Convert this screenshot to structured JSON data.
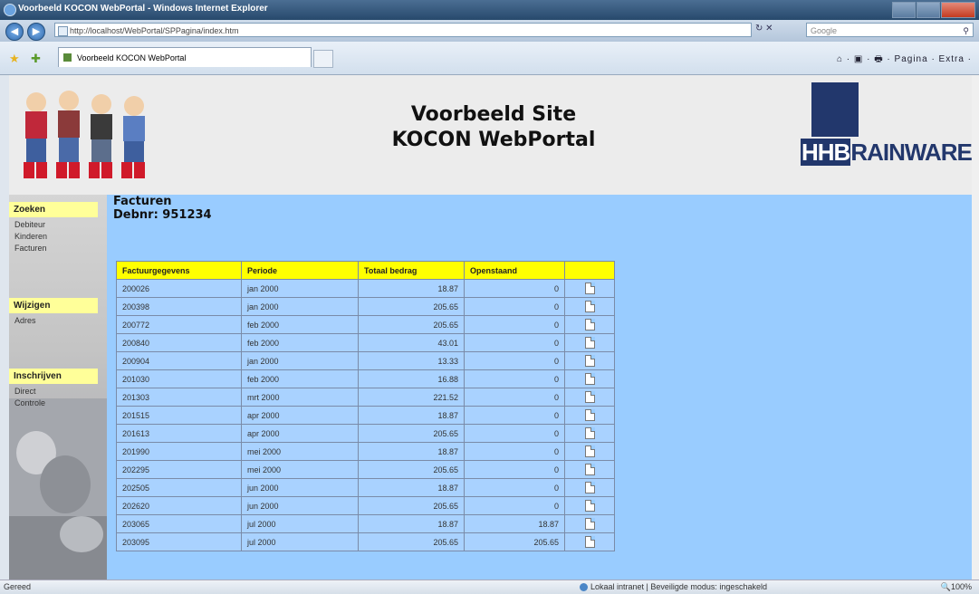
{
  "window": {
    "title": "Voorbeeld KOCON WebPortal - Windows Internet Explorer",
    "address": "http://localhost/WebPortal/SPPagina/index.htm",
    "search_placeholder": "Google",
    "refresh_glyph": "↻",
    "stop_glyph": "✕"
  },
  "tabs": [
    {
      "label": "Voorbeeld KOCON WebPortal"
    }
  ],
  "command_bar": "⌂ · ▣ · 🖶 · Pagina · Extra ·",
  "header": {
    "title_line1": "Voorbeeld Site",
    "title_line2": "KOCON WebPortal",
    "logo_prefix": "HHB",
    "logo_suffix": "RAINWARE"
  },
  "sidebar": {
    "sections": [
      {
        "heading": "Zoeken",
        "links": [
          "Debiteur",
          "Kinderen",
          "Facturen"
        ]
      },
      {
        "heading": "Wijzigen",
        "links": [
          "Adres"
        ]
      },
      {
        "heading": "Inschrijven",
        "links": [
          "Direct",
          "Controle"
        ]
      }
    ]
  },
  "main": {
    "title": "Facturen",
    "subtitle": "Debnr: 951234"
  },
  "table": {
    "headers": [
      "Factuurgegevens",
      "Periode",
      "Totaal bedrag",
      "Openstaand",
      ""
    ],
    "rows": [
      [
        "200026",
        "jan 2000",
        "18.87",
        "0"
      ],
      [
        "200398",
        "jan 2000",
        "205.65",
        "0"
      ],
      [
        "200772",
        "feb 2000",
        "205.65",
        "0"
      ],
      [
        "200840",
        "feb 2000",
        "43.01",
        "0"
      ],
      [
        "200904",
        "jan 2000",
        "13.33",
        "0"
      ],
      [
        "201030",
        "feb 2000",
        "16.88",
        "0"
      ],
      [
        "201303",
        "mrt 2000",
        "221.52",
        "0"
      ],
      [
        "201515",
        "apr 2000",
        "18.87",
        "0"
      ],
      [
        "201613",
        "apr 2000",
        "205.65",
        "0"
      ],
      [
        "201990",
        "mei 2000",
        "18.87",
        "0"
      ],
      [
        "202295",
        "mei 2000",
        "205.65",
        "0"
      ],
      [
        "202505",
        "jun 2000",
        "18.87",
        "0"
      ],
      [
        "202620",
        "jun 2000",
        "205.65",
        "0"
      ],
      [
        "203065",
        "jul 2000",
        "18.87",
        "18.87"
      ],
      [
        "203095",
        "jul 2000",
        "205.65",
        "205.65"
      ]
    ],
    "row_icon": "pdf-document-icon"
  },
  "status": {
    "left": "Gereed",
    "middle": "Lokaal intranet | Beveiligde modus: ingeschakeld",
    "zoom": "100%"
  },
  "colors": {
    "page_background": "#99ccff",
    "table_header": "#ffff00",
    "sidebar_heading": "#ffff99",
    "logo_blue": "#22376c"
  }
}
